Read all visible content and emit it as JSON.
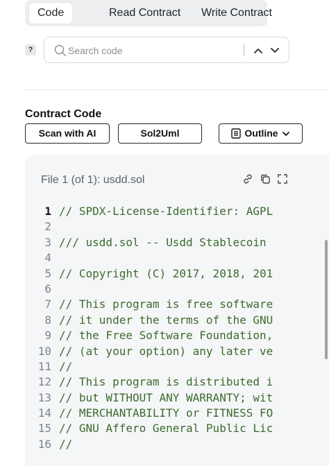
{
  "tabs": [
    {
      "label": "Code",
      "active": true
    },
    {
      "label": "Read Contract",
      "active": false
    },
    {
      "label": "Write Contract",
      "active": false
    }
  ],
  "help": {
    "label": "?"
  },
  "search": {
    "placeholder": "Search code",
    "value": ""
  },
  "contract_code": {
    "title": "Contract Code",
    "buttons": {
      "scan": "Scan with AI",
      "sol2uml": "Sol2Uml",
      "outline": "Outline"
    }
  },
  "file": {
    "label": "File 1 (of 1): usdd.sol"
  },
  "code_lines": [
    {
      "number": "1",
      "text": "// SPDX-License-Identifier: AGPL"
    },
    {
      "number": "2",
      "text": ""
    },
    {
      "number": "3",
      "text": "/// usdd.sol -- Usdd Stablecoin"
    },
    {
      "number": "4",
      "text": ""
    },
    {
      "number": "5",
      "text": "// Copyright (C) 2017, 2018, 201"
    },
    {
      "number": "6",
      "text": ""
    },
    {
      "number": "7",
      "text": "// This program is free software"
    },
    {
      "number": "8",
      "text": "// it under the terms of the GNU"
    },
    {
      "number": "9",
      "text": "// the Free Software Foundation,"
    },
    {
      "number": "10",
      "text": "// (at your option) any later ve"
    },
    {
      "number": "11",
      "text": "//"
    },
    {
      "number": "12",
      "text": "// This program is distributed i"
    },
    {
      "number": "13",
      "text": "// but WITHOUT ANY WARRANTY; wit"
    },
    {
      "number": "14",
      "text": "// MERCHANTABILITY or FITNESS FO"
    },
    {
      "number": "15",
      "text": "// GNU Affero General Public Lic"
    },
    {
      "number": "16",
      "text": "//"
    }
  ],
  "colors": {
    "comment": "#3c6b2f",
    "line_number": "#7d8389",
    "code_background": "#f5f6f7",
    "tab_bar": "#eceef0"
  },
  "icons": [
    "search-icon",
    "chevron-up-icon",
    "chevron-down-icon",
    "outline-list-icon",
    "link-icon",
    "copy-icon",
    "expand-icon"
  ]
}
